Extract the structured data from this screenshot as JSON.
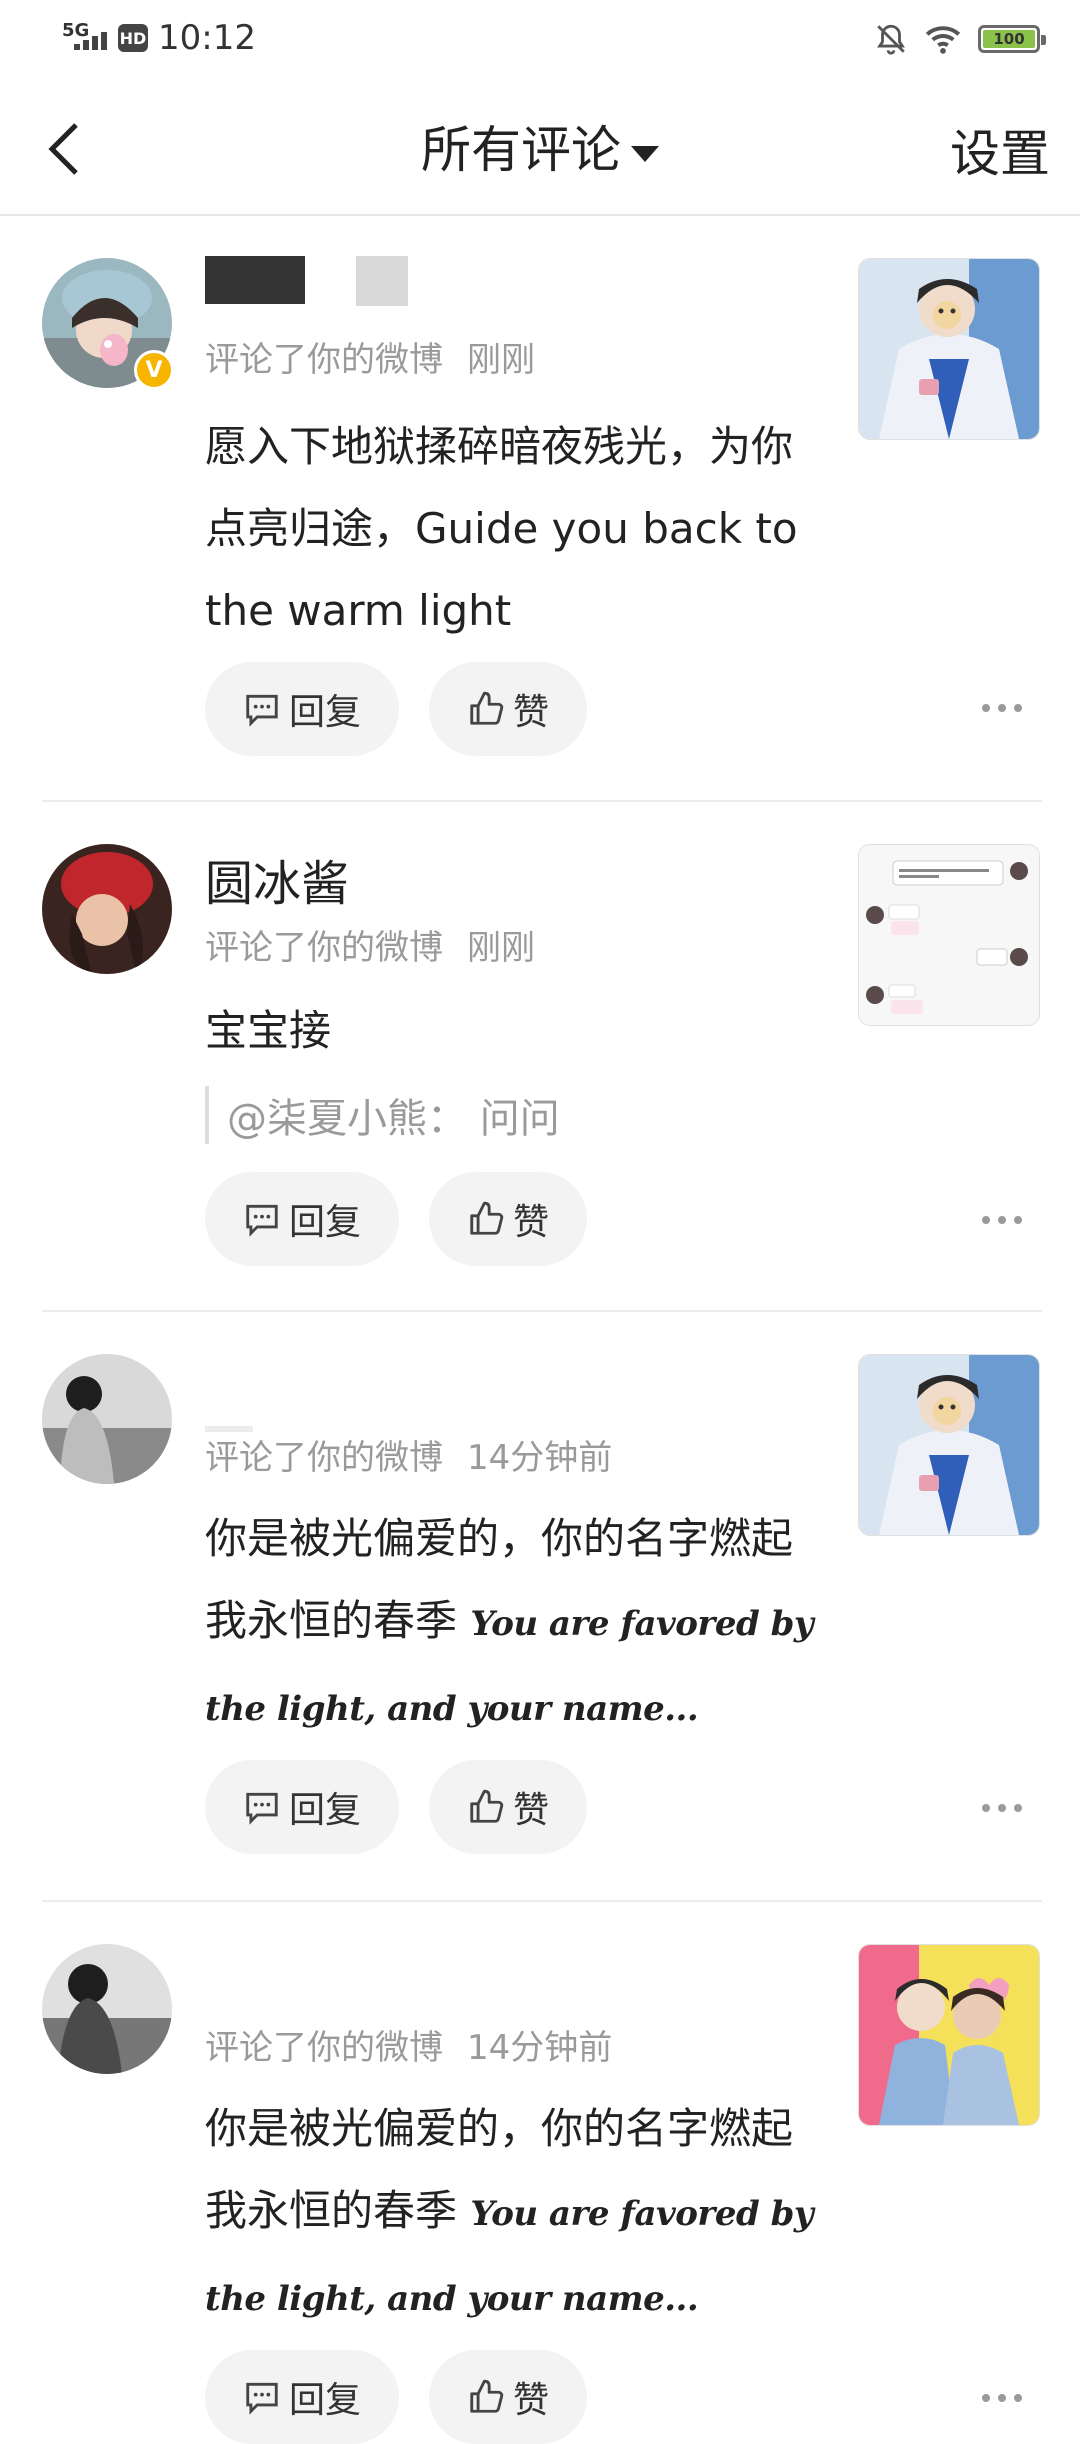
{
  "status_bar": {
    "network": "5G",
    "hd": "HD",
    "time": "10:12",
    "battery": "100"
  },
  "nav": {
    "title": "所有评论",
    "settings": "设置"
  },
  "actions": {
    "reply": "回复",
    "like": "赞"
  },
  "comments": [
    {
      "username": "",
      "verified": true,
      "action_text": "评论了你的微博",
      "time": "刚刚",
      "content": "愿入下地狱揉碎暗夜残光，为你点亮归途，Guide you back to the warm light",
      "quote": ""
    },
    {
      "username": "圆冰酱",
      "verified": false,
      "action_text": "评论了你的微博",
      "time": "刚刚",
      "content": "宝宝接",
      "quote": "@柒夏小熊：  问问"
    },
    {
      "username": "",
      "verified": false,
      "action_text": "评论了你的微博",
      "time": "14分钟前",
      "content_cn": "你是被光偏爱的，你的名字燃起我永恒的春季",
      "content_en": "You are favored by the light, and your name..."
    },
    {
      "username": "",
      "verified": false,
      "action_text": "评论了你的微博",
      "time": "14分钟前",
      "content_cn": "你是被光偏爱的，你的名字燃起我永恒的春季",
      "content_en": "You are favored by the light, and your name..."
    }
  ]
}
